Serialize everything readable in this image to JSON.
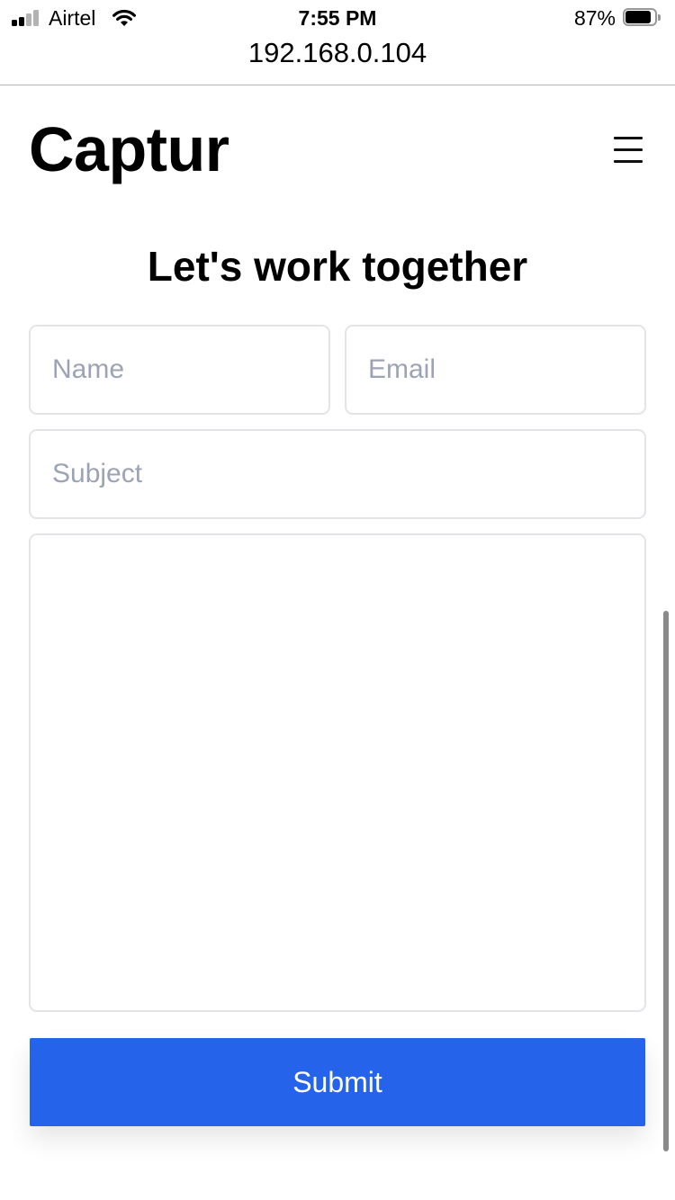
{
  "status_bar": {
    "carrier": "Airtel",
    "time": "7:55 PM",
    "battery_percent": "87%",
    "battery_level": 0.87,
    "signal_bars_active": 2,
    "signal_bars_total": 4,
    "icons": [
      "signal-icon",
      "wifi-icon",
      "battery-icon"
    ]
  },
  "browser": {
    "url": "192.168.0.104"
  },
  "header": {
    "logo": "Captur",
    "menu_icon": "hamburger-menu-icon"
  },
  "contact_form": {
    "heading": "Let's work together",
    "name_placeholder": "Name",
    "email_placeholder": "Email",
    "subject_placeholder": "Subject",
    "name_value": "",
    "email_value": "",
    "subject_value": "",
    "message_value": "",
    "submit_label": "Submit"
  },
  "colors": {
    "accent": "#2563eb",
    "input_border": "#e2e4e8",
    "placeholder": "#9ba3b4",
    "text": "#000000",
    "background": "#ffffff"
  }
}
